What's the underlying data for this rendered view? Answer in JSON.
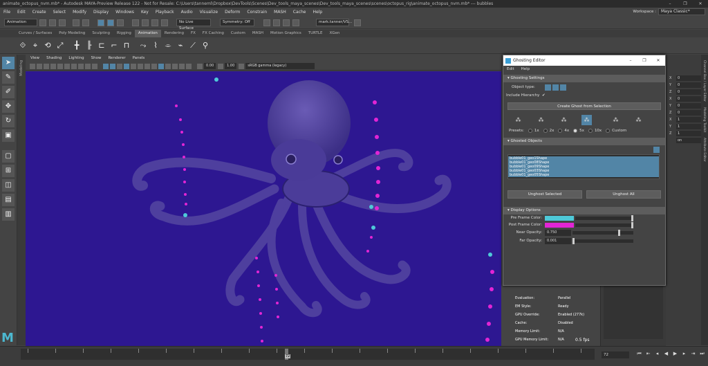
{
  "window": {
    "title": "animate_octopus_nvm.mb* - Autodesk MAYA-Preview Release 122 - Not for Resale: C:\\Users\\tanneml\\Dropbox\\DevTools\\Scenes\\Dev_tools_maya_scenes\\Dev_tools_maya_scenes\\scenes\\octopus_rig\\animate_octopus_nvm.mb* --- bubbles",
    "controls": [
      "–",
      "❐",
      "✕"
    ]
  },
  "menubar": {
    "items": [
      "File",
      "Edit",
      "Create",
      "Select",
      "Modify",
      "Display",
      "Windows",
      "Key",
      "Playback",
      "Audio",
      "Visualize",
      "Deform",
      "Constrain",
      "MASH",
      "Cache",
      "Help"
    ],
    "workspace_label": "Workspace :",
    "workspace_value": "Maya Classic*"
  },
  "statusline": {
    "mode": "Animation",
    "live_surface": "No Live Surface",
    "symmetry": "Symmetry: Off",
    "user": "mark.tanner/VS..."
  },
  "shelf": {
    "tabs": [
      "Curves / Surfaces",
      "Poly Modeling",
      "Sculpting",
      "Rigging",
      "Animation",
      "Rendering",
      "FX",
      "FX Caching",
      "Custom",
      "MASH",
      "Motion Graphics",
      "TURTLE",
      "XGen"
    ],
    "active_tab": "Animation"
  },
  "viewport": {
    "menus": [
      "View",
      "Shading",
      "Lighting",
      "Show",
      "Renderer",
      "Panels"
    ],
    "field_a": "0.00",
    "field_b": "1.00",
    "colorspace": "sRGB gamma (legacy)",
    "side_label": "Modeling",
    "colors": {
      "background": "#2d1791",
      "octopus": "#4e3f9e",
      "ghost_pre": "#4ec9d8",
      "ghost_post": "#e225d5"
    }
  },
  "hud": {
    "rows": [
      {
        "k": "Evaluation:",
        "v": "Parallel"
      },
      {
        "k": "EM Style:",
        "v": "Ready"
      },
      {
        "k": "GPU Override:",
        "v": "Enabled (277k)"
      },
      {
        "k": "Cache:",
        "v": "Disabled"
      },
      {
        "k": "Memory Limit:",
        "v": "N/A"
      },
      {
        "k": "GPU Memory Limit:",
        "v": "N/A"
      }
    ],
    "fps": "0.5 fps"
  },
  "ghosting_editor": {
    "title": "Ghosting Editor",
    "menus": [
      "Edit",
      "Help"
    ],
    "settings_header": "Ghosting Settings",
    "object_type_label": "Object type:",
    "include_hierarchy_label": "Include Hierarchy",
    "create_button": "Create Ghost from Selection",
    "presets_label": "Presets:",
    "presets": [
      "1x",
      "2x",
      "4x",
      "5x",
      "10x",
      "Custom"
    ],
    "preset_selected": "5x",
    "ghosted_header": "Ghosted Objects",
    "ghosted_items": [
      "bubble01_geo1Shape",
      "bubble01_geo08Shape",
      "bubble01_geo09Shape",
      "bubble01_geo03Shape",
      "bubble01_geo05Shape"
    ],
    "unghost_selected": "Unghost Selected",
    "unghost_all": "Unghost All",
    "display_header": "Display Options",
    "pre_frame_label": "Pre Frame Color:",
    "post_frame_label": "Post Frame Color:",
    "near_opacity_label": "Near Opacity:",
    "near_opacity_value": "0.750",
    "far_opacity_label": "Far Opacity:",
    "far_opacity_value": "0.001",
    "pre_frame_color": "#4ec9d8",
    "post_frame_color": "#e225d5"
  },
  "channel_box": {
    "rows": [
      {
        "c": "X",
        "v": "0"
      },
      {
        "c": "Y",
        "v": "0"
      },
      {
        "c": "Z",
        "v": "0"
      },
      {
        "c": "X",
        "v": "0"
      },
      {
        "c": "Y",
        "v": "0"
      },
      {
        "c": "Z",
        "v": "0"
      },
      {
        "c": "X",
        "v": "1"
      },
      {
        "c": "Y",
        "v": "1"
      },
      {
        "c": "Z",
        "v": "1"
      },
      {
        "c": "",
        "v": "on"
      }
    ],
    "side_tabs": [
      "Channel Box / Layer Editor",
      "Modeling Toolkit",
      "Attribute Editor"
    ]
  },
  "timeline": {
    "current_frame_label": "72",
    "frame_field": "72"
  }
}
